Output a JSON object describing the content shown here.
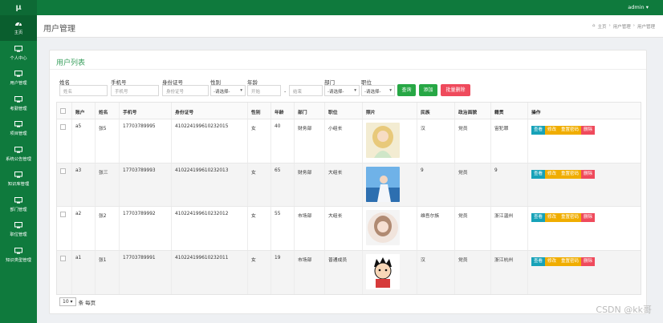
{
  "app": {
    "logo": "μ",
    "user": "admin ▾"
  },
  "sidebar": {
    "items": [
      {
        "label": "主页",
        "icon": "dashboard-icon"
      },
      {
        "label": "个人中心",
        "icon": "monitor-icon"
      },
      {
        "label": "用户管理",
        "icon": "monitor-icon"
      },
      {
        "label": "考勤管理",
        "icon": "monitor-icon"
      },
      {
        "label": "项目管理",
        "icon": "monitor-icon"
      },
      {
        "label": "系统公告管理",
        "icon": "monitor-icon"
      },
      {
        "label": "知识库管理",
        "icon": "monitor-icon"
      },
      {
        "label": "部门管理",
        "icon": "monitor-icon"
      },
      {
        "label": "职位管理",
        "icon": "monitor-icon"
      },
      {
        "label": "知识类型管理",
        "icon": "monitor-icon"
      }
    ]
  },
  "header": {
    "title": "用户管理",
    "crumb_home": "主页",
    "crumb_1": "用户管理",
    "crumb_2": "用户管理",
    "sep": "›"
  },
  "card": {
    "title": "用户列表"
  },
  "filters": {
    "name_label": "姓名",
    "name_ph": "姓名",
    "phone_label": "手机号",
    "phone_ph": "手机号",
    "id_label": "身份证号",
    "id_ph": "身份证号",
    "gender_label": "性别",
    "gender_val": "-请选择-",
    "age_label": "年龄",
    "age_start": "开始",
    "age_dash": "-",
    "age_end": "结束",
    "dept_label": "部门",
    "dept_val": "-请选择-",
    "pos_label": "职位",
    "pos_val": "-请选择-",
    "search": "查询",
    "add": "添加",
    "batch_delete": "批量删除"
  },
  "table": {
    "headers": [
      "账户",
      "姓名",
      "手机号",
      "身份证号",
      "性别",
      "年龄",
      "部门",
      "职位",
      "照片",
      "民族",
      "政治面貌",
      "籍贯",
      "操作"
    ],
    "rows": [
      {
        "account": "a5",
        "name": "张5",
        "phone": "17703789995",
        "id": "410224199610232015",
        "gender": "女",
        "age": "40",
        "dept": "财务部",
        "pos": "小组长",
        "ethnic": "汉",
        "political": "党员",
        "origin": "宙犯罪"
      },
      {
        "account": "a3",
        "name": "张三",
        "phone": "17703789993",
        "id": "410224199610232013",
        "gender": "女",
        "age": "65",
        "dept": "财务部",
        "pos": "大组长",
        "ethnic": "9",
        "political": "党员",
        "origin": "9"
      },
      {
        "account": "a2",
        "name": "张2",
        "phone": "17703789992",
        "id": "410224199610232012",
        "gender": "女",
        "age": "55",
        "dept": "市场部",
        "pos": "大组长",
        "ethnic": "维吾尔族",
        "political": "党员",
        "origin": "浙江温州"
      },
      {
        "account": "a1",
        "name": "张1",
        "phone": "17703789991",
        "id": "410224199610232011",
        "gender": "女",
        "age": "19",
        "dept": "市场部",
        "pos": "普通成员",
        "ethnic": "汉",
        "political": "党员",
        "origin": "浙江杭州"
      }
    ],
    "ops": {
      "view": "查看",
      "edit": "修改",
      "reset": "重置密码",
      "del": "删除"
    }
  },
  "footer": {
    "page_size": "10 ▾",
    "per_page": "条 每页",
    "watermark": "CSDN @kk哥"
  },
  "colors": {
    "sidebar": "#0f7a3d",
    "accent": "#3aa05e",
    "view": "#17a2b8",
    "edit": "#f0ad00",
    "delete": "#ef4a5c",
    "add": "#27a745"
  }
}
